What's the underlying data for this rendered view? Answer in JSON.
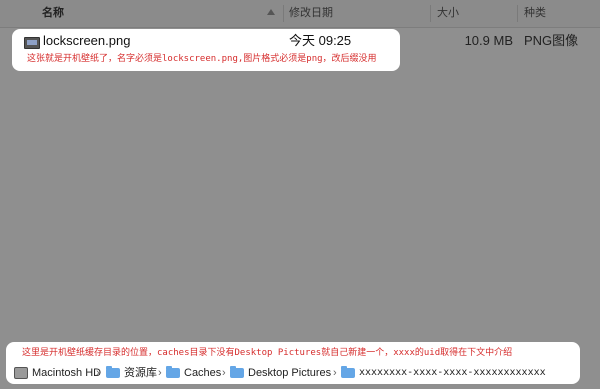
{
  "columns": {
    "name": "名称",
    "date": "修改日期",
    "size": "大小",
    "kind": "种类"
  },
  "file": {
    "name": "lockscreen.png",
    "date": "今天 09:25",
    "size": "10.9 MB",
    "kind": "PNG图像"
  },
  "notes": {
    "top": "这张就是开机壁纸了，名字必须是lockscreen.png,图片格式必须是png，改后缀没用",
    "bottom": "这里是开机壁纸缓存目录的位置，caches目录下没有Desktop Pictures就自己新建一个，xxxx的uid取得在下文中介绍"
  },
  "path": {
    "disk": "Macintosh HD",
    "folder1": "资源库",
    "folder2": "Caches",
    "folder3": "Desktop Pictures",
    "folder4": "xxxxxxxx-xxxx-xxxx-xxxxxxxxxxxx"
  },
  "icons": {
    "file": "image-file-icon",
    "disk": "disk-icon",
    "folder": "folder-icon",
    "separator": "chevron-right-icon"
  },
  "colors": {
    "annotation": "#d62d2d",
    "folder": "#64a6e6"
  }
}
